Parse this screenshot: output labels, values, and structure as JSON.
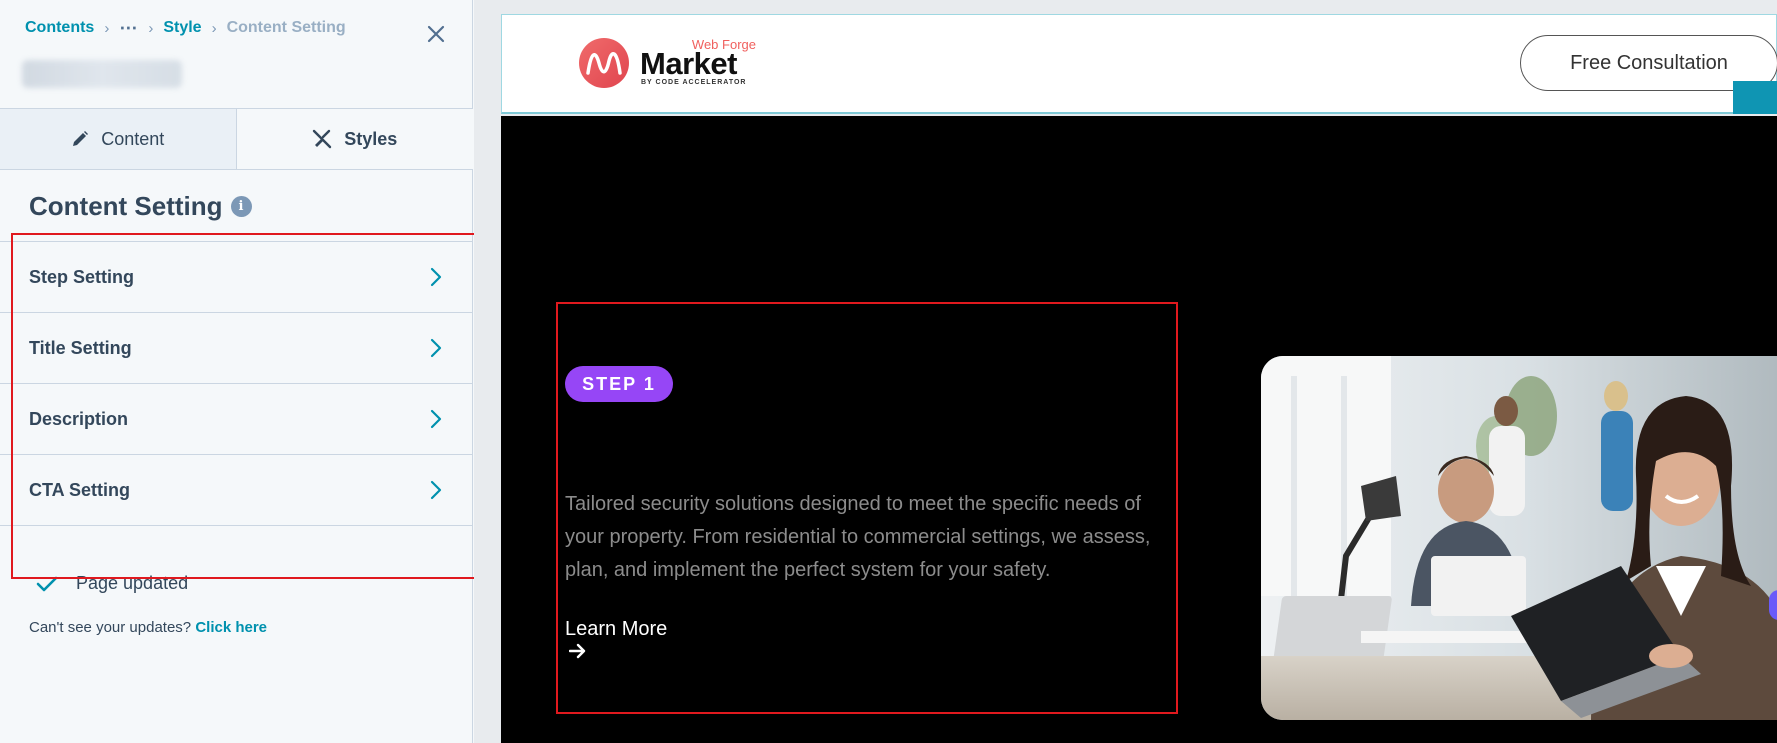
{
  "breadcrumb": {
    "contents": "Contents",
    "ellipsis": "⋯",
    "style": "Style",
    "current": "Content Setting"
  },
  "tabs": [
    {
      "label": "Content",
      "icon": "pencil-icon",
      "active": false
    },
    {
      "label": "Styles",
      "icon": "brush-icon",
      "active": true
    }
  ],
  "section": {
    "title": "Content Setting",
    "info_icon": "i"
  },
  "settings": [
    {
      "label": "Step Setting"
    },
    {
      "label": "Title Setting"
    },
    {
      "label": "Description"
    },
    {
      "label": "CTA Setting"
    }
  ],
  "status": {
    "updated": "Page updated",
    "cant_see": "Can't see your updates?",
    "click_here": "Click here"
  },
  "site": {
    "logo_forge": "Web Forge",
    "logo_market": "Market",
    "logo_by": "BY CODE ACCELERATOR",
    "consult_button": "Free Consultation"
  },
  "hero": {
    "step_badge": "STEP 1",
    "description": "Tailored security solutions designed to meet the specific needs of your property. From residential to commercial settings, we assess, plan, and implement the perfect system for your safety.",
    "cta": "Learn More"
  },
  "colors": {
    "accent_teal": "#0091ae",
    "step_badge": "#9646f6",
    "highlight": "#e0191e",
    "logo_red": "#f0605e"
  }
}
